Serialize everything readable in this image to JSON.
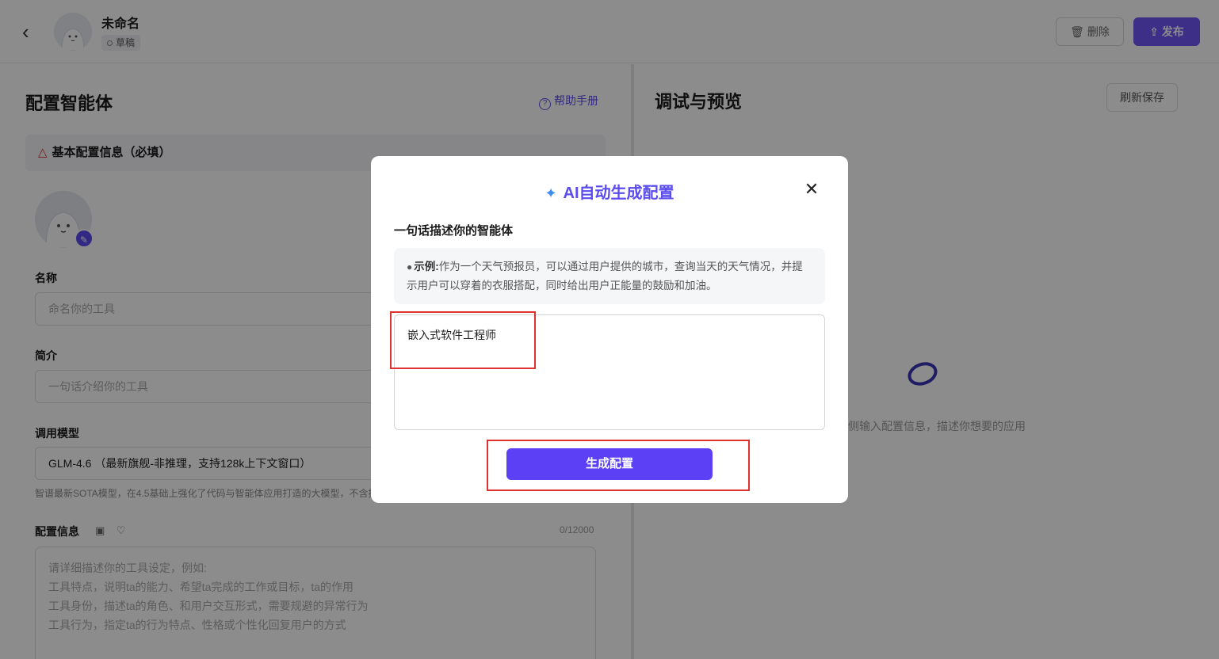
{
  "header": {
    "back_icon": "chevron-left-icon",
    "app_title": "未命名",
    "status_badge": "草稿",
    "delete_label": "删除",
    "publish_label": "发布"
  },
  "left": {
    "title": "配置智能体",
    "help_label": "帮助手册",
    "basic_section": "基本配置信息（必填）",
    "name_label": "名称",
    "name_placeholder": "命名你的工具",
    "intro_label": "简介",
    "intro_placeholder": "一句话介绍你的工具",
    "model_label": "调用模型",
    "model_value": "GLM-4.6 （最新旗舰-非推理，支持128k上下文窗口）",
    "model_hint": "智谱最新SOTA模型，在4.5基础上强化了代码与智能体应用打造的大模型，不含推",
    "config_label": "配置信息",
    "config_counter": "0/12000",
    "config_placeholder_lines": [
      "请详细描述你的工具设定，例如:",
      "  工具特点，说明ta的能力、希望ta完成的工作或目标，ta的作用",
      "  工具身份，描述ta的角色、和用户交互形式，需要规避的异常行为",
      "  工具行为，指定ta的行为特点、性格或个性化回复用户的方式"
    ]
  },
  "right": {
    "title": "调试与预览",
    "refresh_label": "刷新保存",
    "empty_hint": "侧输入配置信息，描述你想要的应用"
  },
  "modal": {
    "title": "AI自动生成配置",
    "label": "一句话描述你的智能体",
    "example_title": "示例:",
    "example_text": "作为一个天气预报员，可以通过用户提供的城市，查询当天的天气情况，并提示用户可以穿着的衣服搭配，同时给出用户正能量的鼓励和加油。",
    "input_value": "嵌入式软件工程师",
    "generate_label": "生成配置"
  },
  "colors": {
    "accent": "#5b40f5",
    "highlight_box": "#e03131"
  }
}
